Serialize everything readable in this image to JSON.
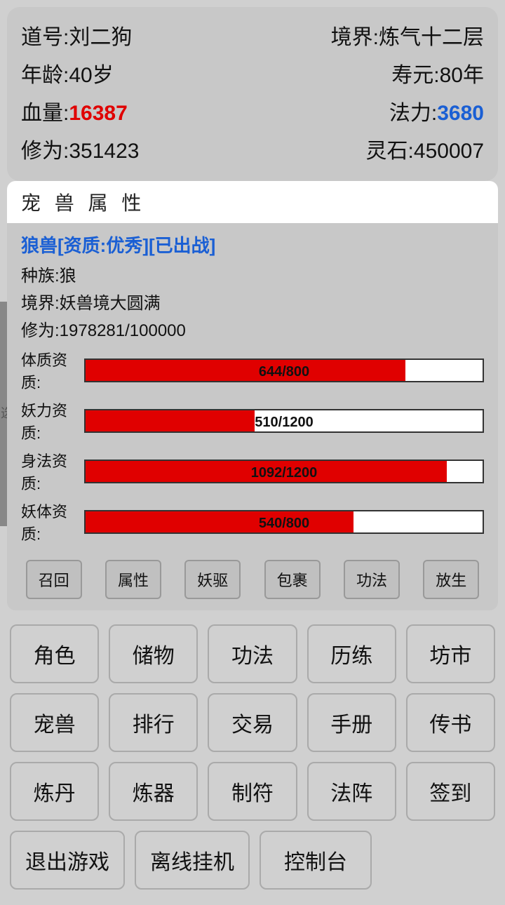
{
  "char": {
    "dao_label": "道号:",
    "dao_value": "刘二狗",
    "realm_label": "境界:",
    "realm_value": "炼气十二层",
    "age_label": "年龄:",
    "age_value": "40岁",
    "lifespan_label": "寿元:",
    "lifespan_value": "80年",
    "hp_label": "血量:",
    "hp_value": "16387",
    "mp_label": "法力:",
    "mp_value": "3680",
    "xiu_label": "修为:",
    "xiu_value": "351423",
    "lingshi_label": "灵石:",
    "lingshi_value": "450007"
  },
  "pet_panel": {
    "title": "宠 兽 属 性",
    "pet_name": "狼兽[资质:优秀][已出战]",
    "race_label": "种族:",
    "race_value": "狼",
    "realm_label": "境界:",
    "realm_value": "妖兽境大圆满",
    "xiu_label": "修为:",
    "xiu_value": "1978281/100000",
    "stats": [
      {
        "label": "体质资质:",
        "current": 644,
        "max": 800,
        "text": "644/800"
      },
      {
        "label": "妖力资质:",
        "current": 510,
        "max": 1200,
        "text": "510/1200"
      },
      {
        "label": "身法资质:",
        "current": 1092,
        "max": 1200,
        "text": "1092/1200"
      },
      {
        "label": "妖体资质:",
        "current": 540,
        "max": 800,
        "text": "540/800"
      }
    ],
    "actions": [
      "召回",
      "属性",
      "妖驱",
      "包裹",
      "功法",
      "放生"
    ]
  },
  "menu": {
    "rows": [
      [
        "角色",
        "储物",
        "功法",
        "历练",
        "坊市"
      ],
      [
        "宠兽",
        "排行",
        "交易",
        "手册",
        "传书"
      ],
      [
        "炼丹",
        "炼器",
        "制符",
        "法阵",
        "签到"
      ],
      [
        "退出游戏",
        "离线挂机",
        "控制台"
      ]
    ]
  }
}
